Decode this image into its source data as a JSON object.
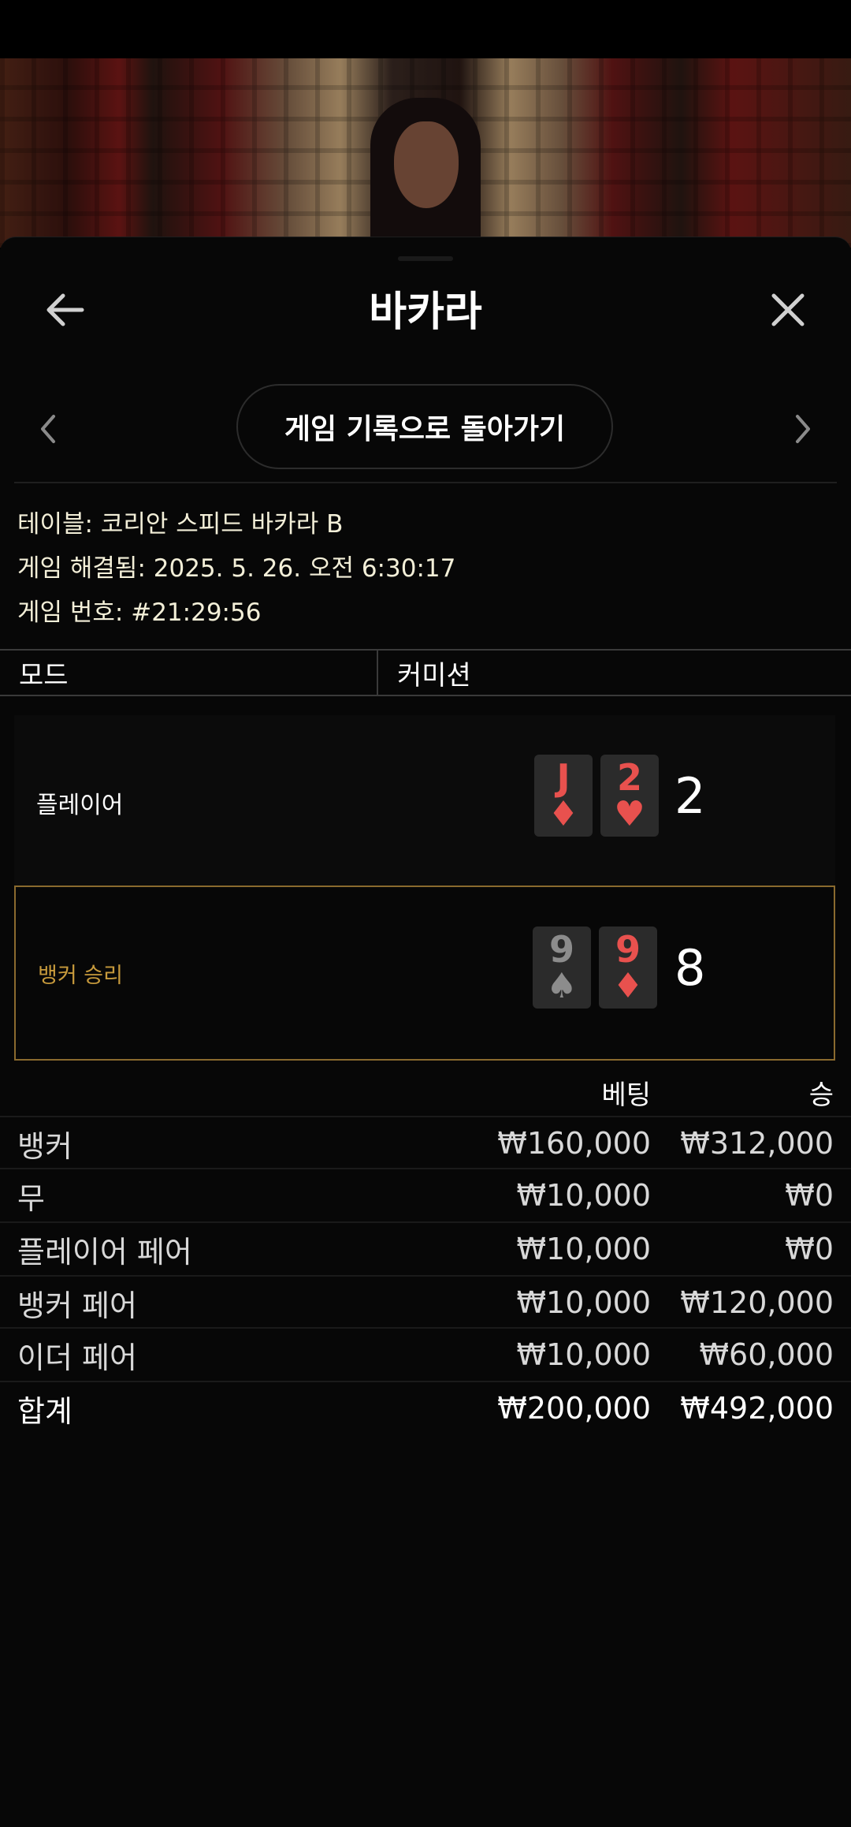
{
  "header": {
    "title": "바카라"
  },
  "nav": {
    "back_to_history": "게임 기록으로 돌아가기"
  },
  "info": {
    "table": "테이블: 코리안 스피드 바카라 B",
    "resolved": "게임 해결됨: 2025. 5. 26. 오전 6:30:17",
    "game_number": "게임 번호: #21:29:56"
  },
  "mode": {
    "label": "모드",
    "value": "커미션"
  },
  "hands": [
    {
      "label": "플레이어",
      "cards": [
        {
          "rank": "J",
          "suit": "♦",
          "color": "red"
        },
        {
          "rank": "2",
          "suit": "♥",
          "color": "red"
        }
      ],
      "score": "2",
      "winner": false
    },
    {
      "label": "뱅커 승리",
      "cards": [
        {
          "rank": "9",
          "suit": "♠",
          "color": "grey"
        },
        {
          "rank": "9",
          "suit": "♦",
          "color": "red"
        }
      ],
      "score": "8",
      "winner": true
    }
  ],
  "bets": {
    "headers": {
      "bet": "베팅",
      "win": "승"
    },
    "rows": [
      {
        "name": "뱅커",
        "bet": "₩160,000",
        "win": "₩312,000"
      },
      {
        "name": "무",
        "bet": "₩10,000",
        "win": "₩0"
      },
      {
        "name": "플레이어 페어",
        "bet": "₩10,000",
        "win": "₩0"
      },
      {
        "name": "뱅커 페어",
        "bet": "₩10,000",
        "win": "₩120,000"
      },
      {
        "name": "이더 페어",
        "bet": "₩10,000",
        "win": "₩60,000"
      }
    ],
    "total": {
      "name": "합계",
      "bet": "₩200,000",
      "win": "₩492,000"
    }
  },
  "colors": {
    "background": "#070707",
    "accent_gold": "#c79a3c",
    "card_red": "#e8514e",
    "card_grey": "#8c8c8c"
  },
  "icons": [
    "back-arrow-icon",
    "close-icon",
    "chevron-left-icon",
    "chevron-right-icon"
  ]
}
